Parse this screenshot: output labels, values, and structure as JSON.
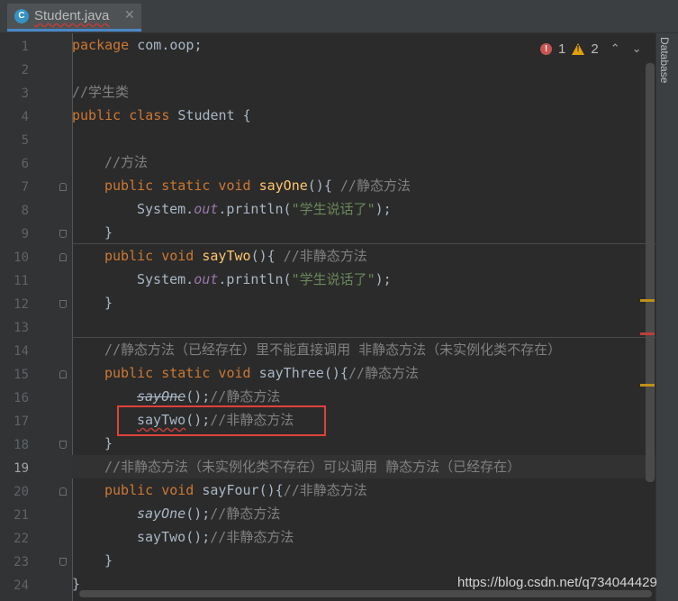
{
  "tab": {
    "icon_letter": "C",
    "file_name": "Student.java",
    "close_glyph": "✕"
  },
  "inspections": {
    "errors": "1",
    "warnings": "2",
    "up_glyph": "⌃",
    "down_glyph": "⌄"
  },
  "sidebar": {
    "label": "Database"
  },
  "watermark": "https://blog.csdn.net/q734044429",
  "line_numbers": [
    "1",
    "2",
    "3",
    "4",
    "5",
    "6",
    "7",
    "8",
    "9",
    "10",
    "11",
    "12",
    "13",
    "14",
    "15",
    "16",
    "17",
    "18",
    "19",
    "20",
    "21",
    "22",
    "23",
    "24"
  ],
  "code": {
    "l1_kw": "package",
    "l1_rest": " com.oop;",
    "l3_cm": "//学生类",
    "l4_kw": "public class",
    "l4_rest": " Student {",
    "l6_cm": "//方法",
    "l7_kw": "public static void",
    "l7_fn": "sayOne",
    "l7_rest": "(){ ",
    "l7_cm": "//静态方法",
    "l8_sys": "System.",
    "l8_out": "out",
    "l8_call": ".println(",
    "l8_str": "\"学生说话了\"",
    "l8_end": ");",
    "l9": "}",
    "l10_kw": "public void",
    "l10_fn": "sayTwo",
    "l10_rest": "(){ ",
    "l10_cm": "//非静态方法",
    "l11_sys": "System.",
    "l11_out": "out",
    "l11_call": ".println(",
    "l11_str": "\"学生说话了\"",
    "l11_end": ");",
    "l12": "}",
    "l14_cm": "//静态方法（已经存在）里不能直接调用 非静态方法（未实例化类不存在）",
    "l15_kw": "public static void",
    "l15_name": "sayThree",
    "l15_rest": "(){",
    "l15_cm": "//静态方法",
    "l16_call": "sayOne",
    "l16_rest": "();",
    "l16_cm": "//静态方法",
    "l17_call": "sayTwo",
    "l17_rest": "();",
    "l17_cm": "//非静态方法",
    "l18": "}",
    "l19_cm": "//非静态方法（未实例化类不存在）可以调用 静态方法（已经存在）",
    "l20_kw": "public void",
    "l20_name": "sayFour",
    "l20_rest": "(){",
    "l20_cm": "//非静态方法",
    "l21_call": "sayOne",
    "l21_rest": "();",
    "l21_cm": "//静态方法",
    "l22_call": "sayTwo",
    "l22_rest": "();",
    "l22_cm": "//非静态方法",
    "l23": "}",
    "l24": "}"
  },
  "colors": {
    "background": "#2b2b2b",
    "keyword": "#cc7832",
    "comment": "#808080",
    "function": "#ffc66d",
    "string": "#6a8759",
    "field": "#9876aa",
    "error": "#c75450",
    "warning": "#e0a00a",
    "highlight_box": "#e0413a"
  }
}
